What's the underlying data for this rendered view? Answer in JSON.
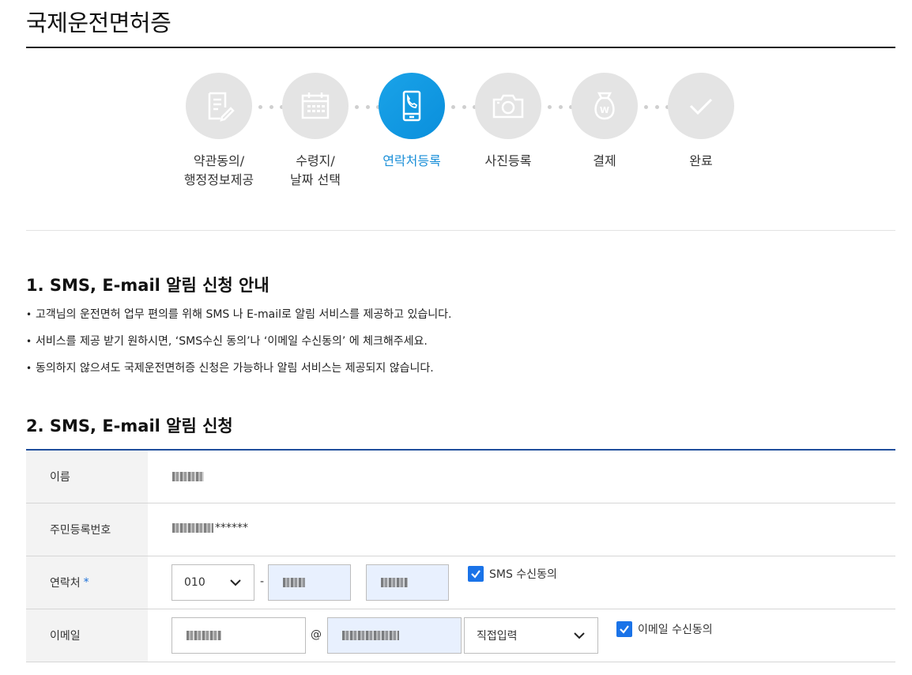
{
  "page": {
    "title": "국제운전면허증"
  },
  "steps": [
    {
      "icon": "document-edit-icon",
      "label": "약관동의/\n행정정보제공",
      "active": false
    },
    {
      "icon": "calendar-icon",
      "label": "수령지/\n날짜 선택",
      "active": false
    },
    {
      "icon": "phone-icon",
      "label": "연락처등록",
      "active": true
    },
    {
      "icon": "camera-icon",
      "label": "사진등록",
      "active": false
    },
    {
      "icon": "money-bag-icon",
      "label": "결제",
      "active": false
    },
    {
      "icon": "checkmark-icon",
      "label": "완료",
      "active": false
    }
  ],
  "section1": {
    "title": "1. SMS, E-mail 알림 신청 안내",
    "bullets": [
      "고객님의 운전면허 업무 편의를 위해 SMS 나 E-mail로 알림 서비스를 제공하고 있습니다.",
      "서비스를 제공 받기 원하시면, ‘SMS수신 동의’나 ‘이메일 수신동의’ 에 체크해주세요.",
      "동의하지 않으셔도 국제운전면허증 신청은 가능하나 알림 서비스는 제공되지 않습니다."
    ]
  },
  "section2": {
    "title": "2. SMS, E-mail 알림 신청",
    "name_label": "이름",
    "rrn_label": "주민등록번호",
    "rrn_masked_suffix": "******",
    "phone_label": "연락처",
    "phone_required_mark": "*",
    "phone_prefix": "010",
    "phone_dash": "-",
    "sms_consent_label": "SMS 수신동의",
    "sms_consent_checked": true,
    "email_label": "이메일",
    "email_at": "@",
    "email_domain_select": "직접입력",
    "email_consent_label": "이메일 수신동의",
    "email_consent_checked": true
  },
  "colors": {
    "accent": "#1a8fd8",
    "form_rule": "#1f4e9c",
    "checkbox": "#1a73e8"
  }
}
